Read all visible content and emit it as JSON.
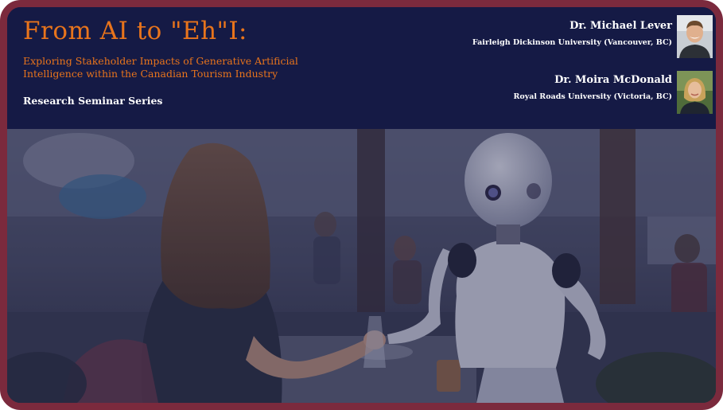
{
  "slide": {
    "title": "From AI to \"Eh\"I:",
    "subtitle": "Exploring Stakeholder Impacts of Generative Artificial Intelligence within the Canadian Tourism Industry",
    "series": "Research Seminar Series"
  },
  "presenters": [
    {
      "name": "Dr. Michael Lever",
      "affiliation": "Fairleigh Dickinson University (Vancouver, BC)",
      "photo_icon": "person-photo-icon"
    },
    {
      "name": "Dr. Moira McDonald",
      "affiliation": "Royal Roads University (Victoria, BC)",
      "photo_icon": "person-photo-icon"
    }
  ],
  "colors": {
    "frame_border": "#7b2a3d",
    "header_bg": "#151a45",
    "title_accent": "#e8741c",
    "text_light": "#ffffff"
  }
}
